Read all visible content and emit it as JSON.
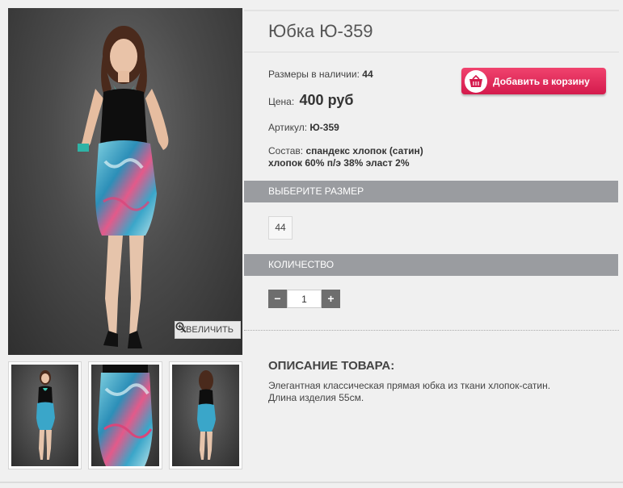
{
  "product": {
    "title": "Юбка Ю-359",
    "sizes_label": "Размеры в наличии:",
    "sizes_value": "44",
    "price_label": "Цена:",
    "price_value": "400 руб",
    "sku_label": "Артикул:",
    "sku_value": "Ю-359",
    "composition_label": "Состав:",
    "composition_line1": "спандекс хлопок (сатин)",
    "composition_line2": "хлопок 60% п/э 38% эласт 2%"
  },
  "cart_button": {
    "label": "Добавить в корзину",
    "icon": "basket-icon"
  },
  "gallery": {
    "zoom_label": "УВЕЛИЧИТЬ",
    "zoom_icon": "magnifier-plus-icon"
  },
  "size_section": {
    "header": "ВЫБЕРИТЕ РАЗМЕР",
    "options": [
      "44"
    ]
  },
  "quantity_section": {
    "header": "КОЛИЧЕСТВО",
    "value": "1",
    "minus": "−",
    "plus": "+"
  },
  "description": {
    "header": "ОПИСАНИЕ ТОВАРА:",
    "line1": "Элегантная классическая прямая юбка из ткани хлопок-сатин.",
    "line2": "Длина изделия 55см."
  },
  "colors": {
    "accent": "#e0245a",
    "section_bar": "#9a9ca0",
    "background": "#f0f0f0"
  }
}
